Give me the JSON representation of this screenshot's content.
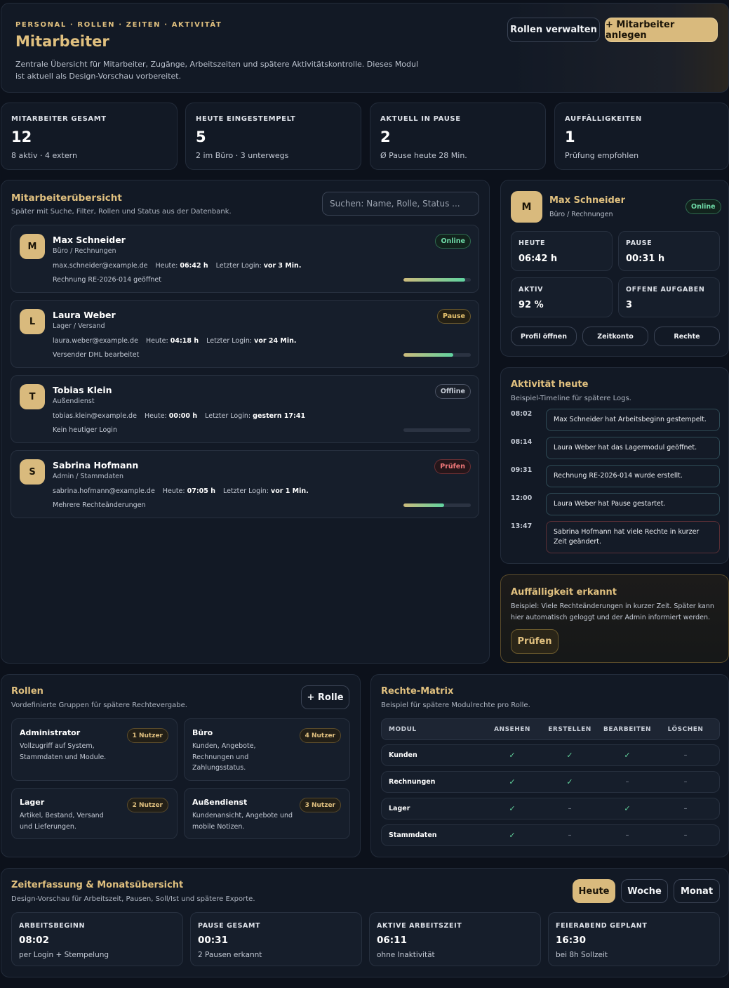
{
  "header": {
    "eyebrow": "PERSONAL · ROLLEN · ZEITEN · AKTIVITÄT",
    "title": "Mitarbeiter",
    "description": "Zentrale Übersicht für Mitarbeiter, Zugänge, Arbeitszeiten und spätere Aktivitätskontrolle. Dieses Modul ist aktuell als Design-Vorschau vorbereitet.",
    "manage_roles_label": "Rollen verwalten",
    "add_employee_label": "+ Mitarbeiter anlegen"
  },
  "stats": [
    {
      "label": "MITARBEITER GESAMT",
      "value": "12",
      "sub": "8 aktiv · 4 extern"
    },
    {
      "label": "HEUTE EINGESTEMPELT",
      "value": "5",
      "sub": "2 im Büro · 3 unterwegs"
    },
    {
      "label": "AKTUELL IN PAUSE",
      "value": "2",
      "sub": "Ø Pause heute 28 Min."
    },
    {
      "label": "AUFFÄLLIGKEITEN",
      "value": "1",
      "sub": "Prüfung empfohlen"
    }
  ],
  "overview": {
    "title": "Mitarbeiterübersicht",
    "subtitle": "Später mit Suche, Filter, Rollen und Status aus der Datenbank.",
    "search_placeholder": "Suchen: Name, Rolle, Status ...",
    "employees": [
      {
        "initial": "M",
        "name": "Max Schneider",
        "role": "Büro / Rechnungen",
        "email": "max.schneider@example.de",
        "today_label": "Heute:",
        "today": "06:42 h",
        "login_label": "Letzter Login:",
        "login": "vor 3 Min.",
        "activity": "Rechnung RE-2026-014 geöffnet",
        "status": "Online",
        "status_type": "online",
        "progress": 0.92
      },
      {
        "initial": "L",
        "name": "Laura Weber",
        "role": "Lager / Versand",
        "email": "laura.weber@example.de",
        "today_label": "Heute:",
        "today": "04:18 h",
        "login_label": "Letzter Login:",
        "login": "vor 24 Min.",
        "activity": "Versender DHL bearbeitet",
        "status": "Pause",
        "status_type": "pause",
        "progress": 0.74
      },
      {
        "initial": "T",
        "name": "Tobias Klein",
        "role": "Außendienst",
        "email": "tobias.klein@example.de",
        "today_label": "Heute:",
        "today": "00:00 h",
        "login_label": "Letzter Login:",
        "login": "gestern 17:41",
        "activity": "Kein heutiger Login",
        "status": "Offline",
        "status_type": "offline",
        "progress": 0
      },
      {
        "initial": "S",
        "name": "Sabrina Hofmann",
        "role": "Admin / Stammdaten",
        "email": "sabrina.hofmann@example.de",
        "today_label": "Heute:",
        "today": "07:05 h",
        "login_label": "Letzter Login:",
        "login": "vor 1 Min.",
        "activity": "Mehrere Rechteänderungen",
        "status": "Prüfen",
        "status_type": "pruefen",
        "progress": 0.6
      }
    ]
  },
  "detail": {
    "initial": "M",
    "name": "Max Schneider",
    "role": "Büro / Rechnungen",
    "status": "Online",
    "metrics": [
      {
        "label": "HEUTE",
        "value": "06:42 h"
      },
      {
        "label": "PAUSE",
        "value": "00:31 h"
      },
      {
        "label": "AKTIV",
        "value": "92 %"
      },
      {
        "label": "OFFENE AUFGABEN",
        "value": "3"
      }
    ],
    "actions": [
      "Profil öffnen",
      "Zeitkonto",
      "Rechte"
    ]
  },
  "activity": {
    "title": "Aktivität heute",
    "subtitle": "Beispiel-Timeline für spätere Logs.",
    "items": [
      {
        "time": "08:02",
        "text": "Max Schneider hat Arbeitsbeginn gestempelt.",
        "alert": false
      },
      {
        "time": "08:14",
        "text": "Laura Weber hat das Lagermodul geöffnet.",
        "alert": false
      },
      {
        "time": "09:31",
        "text": "Rechnung RE-2026-014 wurde erstellt.",
        "alert": false
      },
      {
        "time": "12:00",
        "text": "Laura Weber hat Pause gestartet.",
        "alert": false
      },
      {
        "time": "13:47",
        "text": "Sabrina Hofmann hat viele Rechte in kurzer Zeit geändert.",
        "alert": true
      }
    ]
  },
  "warning": {
    "title": "Auffälligkeit erkannt",
    "text": "Beispiel: Viele Rechteänderungen in kurzer Zeit. Später kann hier automatisch geloggt und der Admin informiert werden.",
    "button": "Prüfen"
  },
  "roles": {
    "title": "Rollen",
    "subtitle": "Vordefinierte Gruppen für spätere Rechtevergabe.",
    "add_label": "+ Rolle",
    "items": [
      {
        "name": "Administrator",
        "desc": "Vollzugriff auf System, Stammdaten und Module.",
        "count": "1 Nutzer"
      },
      {
        "name": "Büro",
        "desc": "Kunden, Angebote, Rechnungen und Zahlungsstatus.",
        "count": "4 Nutzer"
      },
      {
        "name": "Lager",
        "desc": "Artikel, Bestand, Versand und Lieferungen.",
        "count": "2 Nutzer"
      },
      {
        "name": "Außendienst",
        "desc": "Kundenansicht, Angebote und mobile Notizen.",
        "count": "3 Nutzer"
      }
    ]
  },
  "matrix": {
    "title": "Rechte-Matrix",
    "subtitle": "Beispiel für spätere Modulrechte pro Rolle.",
    "columns": [
      "MODUL",
      "ANSEHEN",
      "ERSTELLEN",
      "BEARBEITEN",
      "LÖSCHEN"
    ],
    "rows": [
      {
        "module": "Kunden",
        "cells": [
          "✓",
          "✓",
          "✓",
          "–"
        ]
      },
      {
        "module": "Rechnungen",
        "cells": [
          "✓",
          "✓",
          "–",
          "–"
        ]
      },
      {
        "module": "Lager",
        "cells": [
          "✓",
          "–",
          "✓",
          "–"
        ]
      },
      {
        "module": "Stammdaten",
        "cells": [
          "✓",
          "–",
          "–",
          "–"
        ]
      }
    ]
  },
  "time": {
    "title": "Zeiterfassung & Monatsübersicht",
    "subtitle": "Design-Vorschau für Arbeitszeit, Pausen, Soll/Ist und spätere Exporte.",
    "tabs": [
      "Heute",
      "Woche",
      "Monat"
    ],
    "active_tab": "Heute",
    "cards": [
      {
        "label": "ARBEITSBEGINN",
        "value": "08:02",
        "sub": "per Login + Stempelung"
      },
      {
        "label": "PAUSE GESAMT",
        "value": "00:31",
        "sub": "2 Pausen erkannt"
      },
      {
        "label": "AKTIVE ARBEITSZEIT",
        "value": "06:11",
        "sub": "ohne Inaktivität"
      },
      {
        "label": "FEIERABEND GEPLANT",
        "value": "16:30",
        "sub": "bei 8h Sollzeit"
      }
    ]
  }
}
